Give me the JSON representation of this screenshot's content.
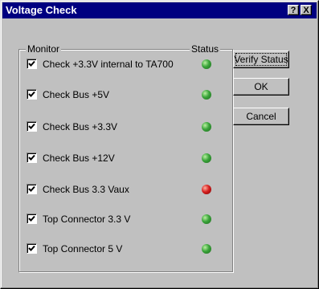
{
  "window": {
    "title": "Voltage Check"
  },
  "titlebar": {
    "help_label": "?",
    "close_label": "X"
  },
  "monitor": {
    "group_label": "Monitor",
    "status_label": "Status",
    "items": [
      {
        "label": "Check +3.3V internal to TA700",
        "checked": true,
        "status": "ok"
      },
      {
        "label": "Check Bus +5V",
        "checked": true,
        "status": "ok"
      },
      {
        "label": "Check Bus +3.3V",
        "checked": true,
        "status": "ok"
      },
      {
        "label": "Check Bus +12V",
        "checked": true,
        "status": "ok"
      },
      {
        "label": "Check Bus 3.3 Vaux",
        "checked": true,
        "status": "fail"
      },
      {
        "label": "Top Connector 3.3 V",
        "checked": true,
        "status": "ok"
      },
      {
        "label": "Top Connector 5 V",
        "checked": true,
        "status": "ok"
      }
    ]
  },
  "buttons": {
    "verify": "Verify Status",
    "ok": "OK",
    "cancel": "Cancel"
  },
  "colors": {
    "status_ok": "#3aa43a",
    "status_fail": "#d62020",
    "title_bar": "#000080"
  }
}
